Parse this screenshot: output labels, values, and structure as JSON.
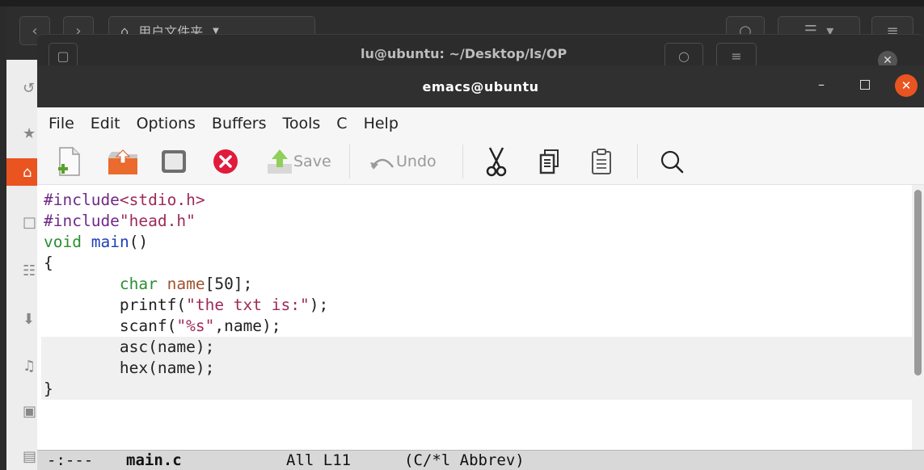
{
  "files_window": {
    "path_label": "用户文件夹",
    "sidebar_icons": [
      "recent-icon",
      "starred-icon",
      "home-icon",
      "desktop-icon",
      "documents-icon",
      "downloads-icon",
      "music-icon",
      "pictures-icon",
      "videos-icon"
    ]
  },
  "terminal_window": {
    "title": "lu@ubuntu: ~/Desktop/ls/OP"
  },
  "emacs": {
    "title": "emacs@ubuntu",
    "menu": [
      "File",
      "Edit",
      "Options",
      "Buffers",
      "Tools",
      "C",
      "Help"
    ],
    "toolbar": {
      "save_label": "Save",
      "undo_label": "Undo"
    },
    "code_lines": [
      "#include<stdio.h>",
      "#include\"head.h\"",
      "void main()",
      "{",
      "        char name[50];",
      "        printf(\"the txt is:\");",
      "        scanf(\"%s\",name);",
      "        asc(name);",
      "        hex(name);",
      "}"
    ],
    "modeline": {
      "status": "-:---",
      "buffer": "main.c",
      "position": "All L11",
      "modes": "(C/*l Abbrev)"
    }
  },
  "colors": {
    "accent": "#e95420",
    "titlebar": "#303030",
    "preprocessor": "#6f2a86",
    "string": "#9d2a58",
    "type": "#2a8f30",
    "function": "#1e3fb8",
    "variable": "#a0522d"
  }
}
